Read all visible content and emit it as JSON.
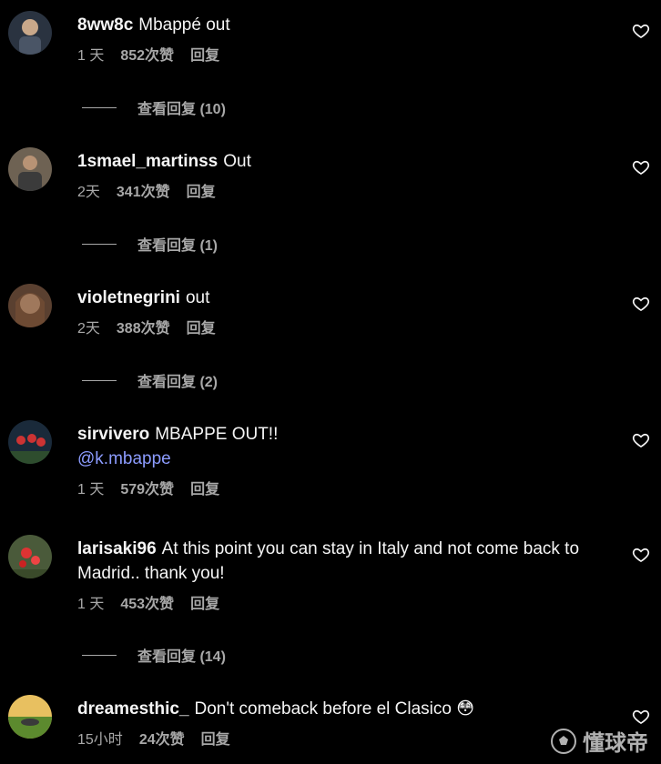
{
  "comments": [
    {
      "username": "8ww8c",
      "text": "Mbappé out",
      "mention": "",
      "age": "1 天",
      "likes": "852次赞",
      "reply_label": "回复",
      "view_replies": "查看回复 (10)",
      "avatar_color": "#3d4a5c"
    },
    {
      "username": "1smael_martinss",
      "text": "Out",
      "mention": "",
      "age": "2天",
      "likes": "341次赞",
      "reply_label": "回复",
      "view_replies": "查看回复 (1)",
      "avatar_color": "#8a7a66"
    },
    {
      "username": "violetnegrini",
      "text": "out",
      "mention": "",
      "age": "2天",
      "likes": "388次赞",
      "reply_label": "回复",
      "view_replies": "查看回复 (2)",
      "avatar_color": "#b58a6a"
    },
    {
      "username": "sirvivero",
      "text": "MBAPPE OUT!!",
      "mention": "@k.mbappe",
      "age": "1 天",
      "likes": "579次赞",
      "reply_label": "回复",
      "view_replies": "",
      "avatar_color": "#1f3a4a"
    },
    {
      "username": "larisaki96",
      "text": "At this point you can stay in Italy and not come back to Madrid.. thank you!",
      "mention": "",
      "age": "1 天",
      "likes": "453次赞",
      "reply_label": "回复",
      "view_replies": "查看回复 (14)",
      "avatar_color": "#6b7d4a"
    },
    {
      "username": "dreamesthic_",
      "text": "Don't comeback before el Clasico 😳",
      "mention": "",
      "age": "15小时",
      "likes": "24次赞",
      "reply_label": "回复",
      "view_replies": "",
      "avatar_color": "#7ea04a"
    }
  ],
  "watermark": {
    "text": "懂球帝"
  }
}
